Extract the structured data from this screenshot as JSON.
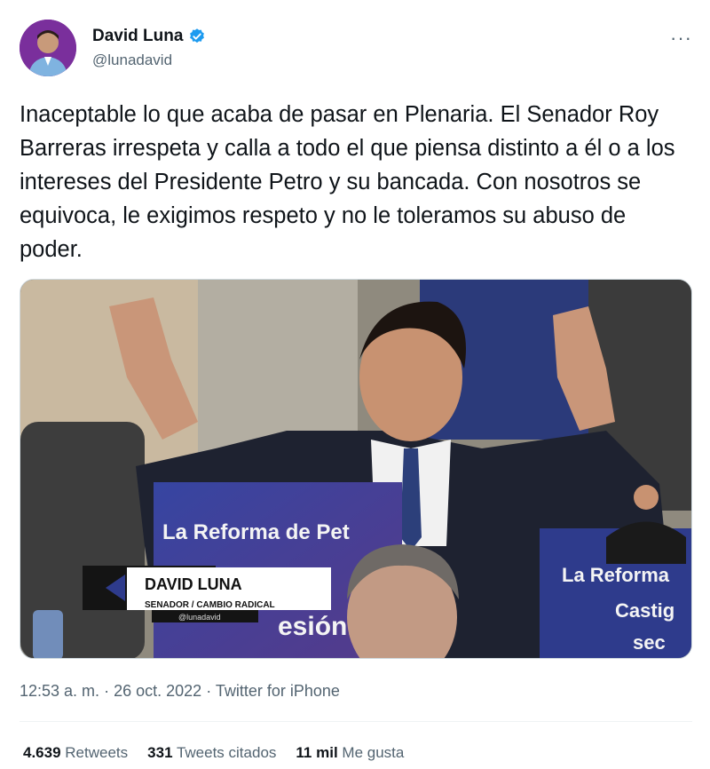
{
  "author": {
    "display_name": "David Luna",
    "handle": "@lunadavid",
    "avatar_icon": "avatar-photo",
    "verified_icon": "verified-badge-icon",
    "verified_color": "#1d9bf0"
  },
  "more_icon": "more-options-icon",
  "tweet": {
    "text": "Inaceptable lo que acaba de pasar en Plenaria. El Senador Roy Barreras irrespeta y calla a todo el que piensa distinto a él o a los intereses del Presidente Petro y su bancada. Con nosotros se equivoca, le exigimos respeto y no le toleramos su abuso de poder."
  },
  "media": {
    "sign_left": "La Reforma de Pet",
    "sign_left_2": "esión.",
    "sign_right": "La Reforma",
    "sign_right_2": "Castig",
    "sign_right_3": "sec",
    "lower_third_name": "DAVID LUNA",
    "lower_third_role": "SENADOR / CAMBIO RADICAL",
    "lower_third_handle": "@lunadavid"
  },
  "meta": {
    "time": "12:53 a. m.",
    "date": "26 oct. 2022",
    "source": "Twitter for iPhone"
  },
  "stats": {
    "retweets_count": "4.639",
    "retweets_label": "Retweets",
    "quotes_count": "331",
    "quotes_label": "Tweets citados",
    "likes_count": "11 mil",
    "likes_label": "Me gusta"
  },
  "colors": {
    "text": "#0f1419",
    "secondary": "#536471",
    "border": "#cfd9de"
  }
}
